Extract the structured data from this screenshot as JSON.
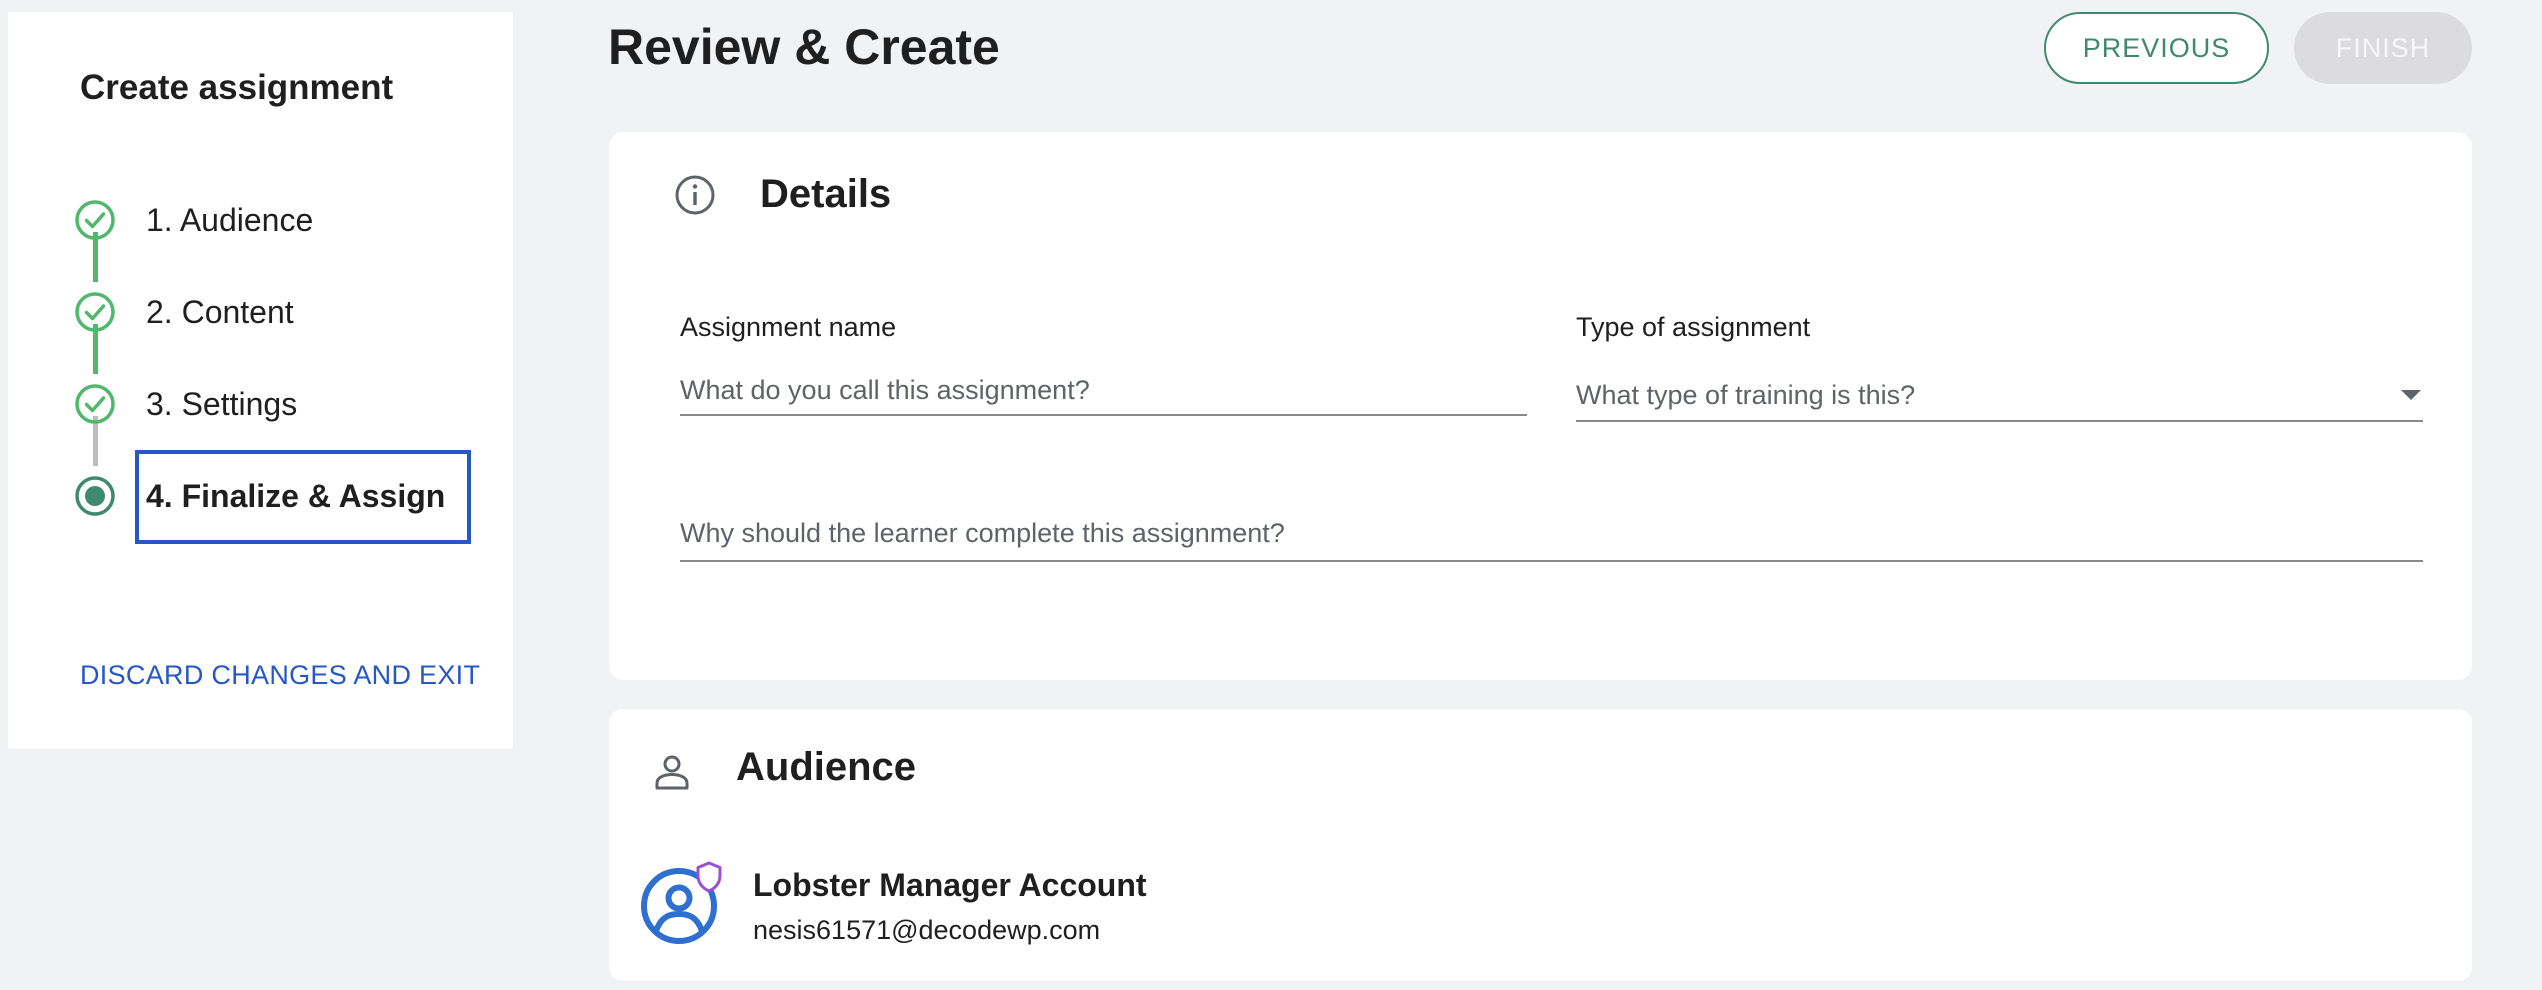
{
  "sidebar": {
    "title": "Create assignment",
    "steps": [
      {
        "label": "1. Audience",
        "status": "complete"
      },
      {
        "label": "2. Content",
        "status": "complete"
      },
      {
        "label": "3. Settings",
        "status": "complete"
      },
      {
        "label": "4. Finalize & Assign",
        "status": "active"
      }
    ],
    "discard_label": "DISCARD CHANGES AND EXIT"
  },
  "header": {
    "title": "Review & Create",
    "previous_label": "PREVIOUS",
    "finish_label": "FINISH"
  },
  "details": {
    "heading": "Details",
    "assignment_name_label": "Assignment name",
    "assignment_name_placeholder": "What do you call this assignment?",
    "type_label": "Type of assignment",
    "type_placeholder": "What type of training is this?",
    "reason_placeholder": "Why should the learner complete this assignment?"
  },
  "audience": {
    "heading": "Audience",
    "user_name": "Lobster Manager Account",
    "user_email": "nesis61571@decodewp.com"
  },
  "colors": {
    "accent_green": "#3f8a6e",
    "step_complete": "#4fb86b",
    "link_blue": "#2557c6",
    "avatar_blue": "#2e6fd1",
    "shield_purple": "#9b4fd8"
  },
  "icons": {
    "step_complete": "check-circle-icon",
    "step_active": "radio-active-icon",
    "details": "info-icon",
    "audience": "person-icon",
    "avatar": "user-avatar-icon",
    "admin_badge": "shield-icon",
    "type_dropdown": "caret-down-icon"
  }
}
